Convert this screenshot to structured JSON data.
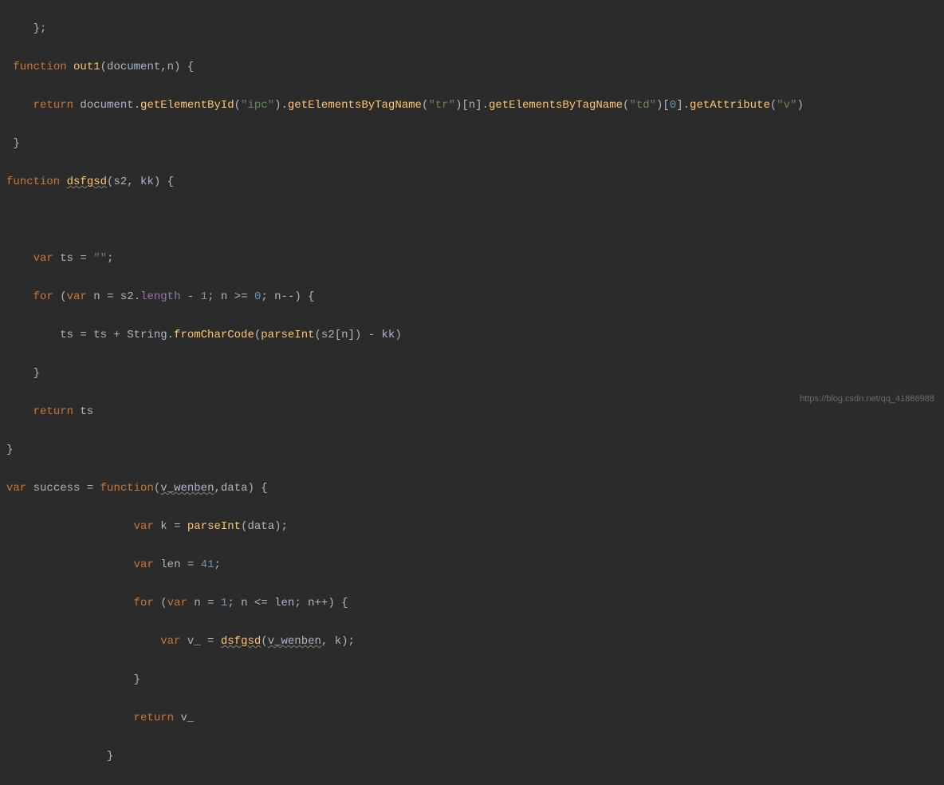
{
  "code": {
    "line1_close": "};",
    "line2": {
      "keyword_function": "function",
      "fname": "out1",
      "params": "(document,n) {"
    },
    "line3": {
      "indent": "    ",
      "keyword_return": "return",
      "expr_p1": " document.",
      "method1": "getElementById",
      "str1": "\"ipc\"",
      "expr_p2": ").",
      "method2": "getElementsByTagName",
      "str2": "\"tr\"",
      "expr_p3": ")[n].",
      "method3": "getElementsByTagName",
      "str3": "\"td\"",
      "expr_p4": ")[",
      "num0": "0",
      "expr_p5": "].",
      "method4": "getAttribute",
      "str4": "\"v\"",
      "expr_p6": ")"
    },
    "line4_close": "}",
    "line5": {
      "keyword_function": "function",
      "fname": "dsfgsd",
      "params": "(s2, kk) {"
    },
    "line7": {
      "indent": "    ",
      "keyword_var": "var",
      "varname": " ts = ",
      "str_empty": "\"\"",
      "semi": ";"
    },
    "line8": {
      "indent": "    ",
      "keyword_for": "for",
      "open": " (",
      "keyword_var": "var",
      "expr1": " n = s2.",
      "prop_length": "length",
      "expr2": " - ",
      "num1": "1",
      "expr3": "; n >= ",
      "num0": "0",
      "expr4": "; n--) {"
    },
    "line9": {
      "indent": "        ",
      "expr1": "ts = ts + String.",
      "method": "fromCharCode",
      "expr2": "(",
      "fn_parseInt": "parseInt",
      "expr3": "(s2[n]) - kk)"
    },
    "line10": {
      "indent": "    ",
      "close": "}"
    },
    "line11": {
      "indent": "    ",
      "keyword_return": "return",
      "expr": " ts"
    },
    "line12_close": "}",
    "line13": {
      "keyword_var": "var",
      "varname": " success = ",
      "keyword_function": "function",
      "open": "(",
      "param1": "v_wenben",
      "comma": ",data) {"
    },
    "line14": {
      "indent": "                   ",
      "keyword_var": "var",
      "expr1": " k = ",
      "fn_parseInt": "parseInt",
      "expr2": "(data);"
    },
    "line15": {
      "indent": "                   ",
      "keyword_var": "var",
      "expr1": " len = ",
      "num41": "41",
      "semi": ";"
    },
    "line16": {
      "indent": "                   ",
      "keyword_for": "for",
      "open": " (",
      "keyword_var": "var",
      "expr1": " n = ",
      "num1": "1",
      "expr2": "; n <= len; n++) {"
    },
    "line17": {
      "indent": "                       ",
      "keyword_var": "var",
      "expr1": " v_ = ",
      "fname": "dsfgsd",
      "open": "(",
      "param1": "v_wenben",
      "expr2": ", k);"
    },
    "line18": {
      "indent": "                   ",
      "close": "}"
    },
    "line19": {
      "indent": "                   ",
      "keyword_return": "return",
      "expr": " v_"
    },
    "line20": {
      "indent": "               ",
      "close": "}"
    }
  },
  "watermark": "https://blog.csdn.net/qq_41866988"
}
